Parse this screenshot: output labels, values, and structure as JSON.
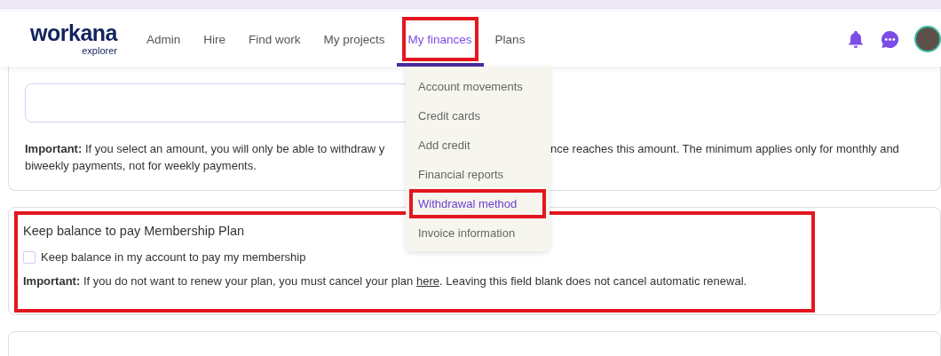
{
  "logo": {
    "name": "workana",
    "tagline": "explorer"
  },
  "nav": [
    {
      "label": "Admin",
      "selected": false,
      "highlighted": false
    },
    {
      "label": "Hire",
      "selected": false,
      "highlighted": false
    },
    {
      "label": "Find work",
      "selected": false,
      "highlighted": false
    },
    {
      "label": "My projects",
      "selected": false,
      "highlighted": false
    },
    {
      "label": "My finances",
      "selected": true,
      "highlighted": true
    },
    {
      "label": "Plans",
      "selected": false,
      "highlighted": false
    }
  ],
  "finances_menu": [
    {
      "label": "Account movements",
      "selected": false,
      "highlighted": false
    },
    {
      "label": "Credit cards",
      "selected": false,
      "highlighted": false
    },
    {
      "label": "Add credit",
      "selected": false,
      "highlighted": false
    },
    {
      "label": "Financial reports",
      "selected": false,
      "highlighted": false
    },
    {
      "label": "Withdrawal method",
      "selected": true,
      "highlighted": true
    },
    {
      "label": "Invoice information",
      "selected": false,
      "highlighted": false
    }
  ],
  "withdraw_section": {
    "note_label": "Important:",
    "note_parts": [
      "If you select an amount, you will only be able to withdraw y",
      "nce reaches this amount. The minimum applies only for monthly and",
      "biweekly payments, not for weekly payments."
    ]
  },
  "membership_section": {
    "title": "Keep balance to pay Membership Plan",
    "highlighted": true,
    "checkbox": {
      "label": "Keep balance in my account to pay my membership",
      "checked": false
    },
    "note_label": "Important:",
    "note_before": "If you do not want to renew your plan, you must cancel your plan",
    "link": "here",
    "note_after": ". Leaving this field blank does not cancel automatic renewal."
  }
}
